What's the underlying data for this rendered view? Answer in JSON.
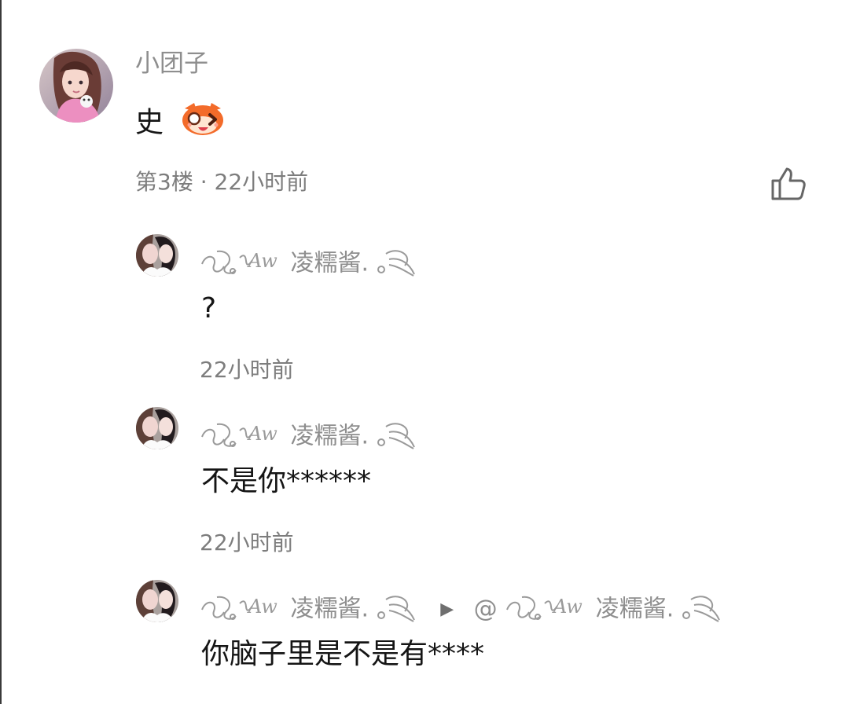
{
  "comment": {
    "username": "小团子",
    "text": "史",
    "emoji": "laughing-fox-emoji",
    "floor_time": "第3楼 · 22小时前",
    "like_icon": "thumbs-up-icon"
  },
  "replies": [
    {
      "username": "凌糯酱.",
      "text": "?",
      "time": "22小时前"
    },
    {
      "username": "凌糯酱.",
      "text": "不是你******",
      "time": "22小时前"
    },
    {
      "username": "凌糯酱.",
      "reply_to": "@",
      "reply_to_username": "凌糯酱.",
      "text": "你脑子里是不是有****"
    }
  ],
  "colors": {
    "name": "#8e8e8e",
    "meta": "#7d7d7d",
    "text": "#151515",
    "emoji": "#f36b2a"
  }
}
